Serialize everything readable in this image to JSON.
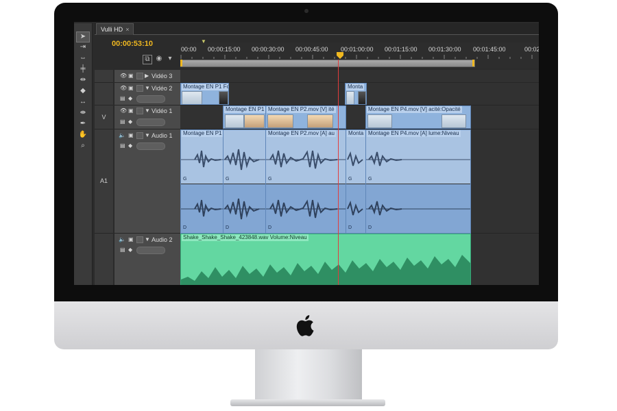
{
  "window": {
    "sequence_tab": "Vulli HD",
    "close_glyph": "×"
  },
  "timecode": "00:00:53:10",
  "ruler": {
    "labels": [
      "00:00",
      "00:00:15:00",
      "00:00:30:00",
      "00:00:45:00",
      "00:01:00:00",
      "00:01:15:00",
      "00:01:30:00",
      "00:01:45:00",
      "00:02"
    ]
  },
  "tracks": {
    "video3": {
      "source": "",
      "name": "Vidéo 3"
    },
    "video2": {
      "source": "",
      "name": "Vidéo 2"
    },
    "video1": {
      "source": "V",
      "name": "Vidéo 1"
    },
    "audio1": {
      "source": "A1",
      "name": "Audio 1"
    },
    "audio2": {
      "source": "",
      "name": "Audio 2"
    }
  },
  "clips": {
    "v2_a": "Montage EN P1",
    "v2_a_suffix": "Fo",
    "v2_b": "Monta",
    "v1_a": "Montage EN P1",
    "v1_b": "Montage EN P2.mov [V]",
    "v1_b_suffix": "ité",
    "v1_c": "Montage EN P4.mov [V]",
    "v1_c_suffix": "acité:Opacité",
    "a1_a": "Montage EN P1",
    "a1_b": "Montage EN P2.mov [A]",
    "a1_b_suffix": "au",
    "a1_c": "Monta",
    "a1_d": "Montage EN P4.mov [A]",
    "a1_d_suffix": "lume:Niveau",
    "channel_left": "G",
    "channel_right": "D",
    "a2_music": "Shake_Shake_Shake_423848.wav",
    "a2_music_effect": "Volume:Niveau"
  },
  "icons": {
    "eye": "eye-icon",
    "film": "film-icon",
    "speaker": "speaker-icon",
    "apple": "apple-logo"
  },
  "colors": {
    "timecode": "#f0b820",
    "video_clip": "#8fb3dd",
    "audio_clip": "#a9c3e2",
    "music_clip": "#63d7a1",
    "playhead": "#e23c3c"
  }
}
